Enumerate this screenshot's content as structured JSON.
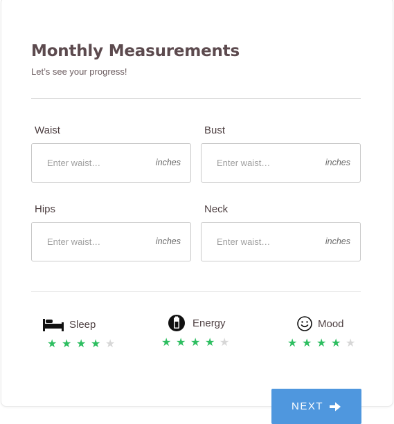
{
  "header": {
    "title": "Monthly Measurements",
    "subtitle": "Let’s see your progress!"
  },
  "fields": [
    {
      "label": "Waist",
      "placeholder": "Enter waist…",
      "unit": "inches"
    },
    {
      "label": "Bust",
      "placeholder": "Enter waist…",
      "unit": "inches"
    },
    {
      "label": "Hips",
      "placeholder": "Enter waist…",
      "unit": "inches"
    },
    {
      "label": "Neck",
      "placeholder": "Enter waist…",
      "unit": "inches"
    }
  ],
  "ratings": [
    {
      "label": "Sleep",
      "icon": "bed-icon",
      "value": 4,
      "max": 5
    },
    {
      "label": "Energy",
      "icon": "battery-icon",
      "value": 4,
      "max": 5
    },
    {
      "label": "Mood",
      "icon": "smiley-icon",
      "value": 4,
      "max": 5
    }
  ],
  "actions": {
    "next_label": "NEXT"
  },
  "colors": {
    "star_on": "#2dbe60",
    "star_off": "#d7d7d7",
    "button": "#4f97de",
    "title": "#5c4a4e"
  }
}
